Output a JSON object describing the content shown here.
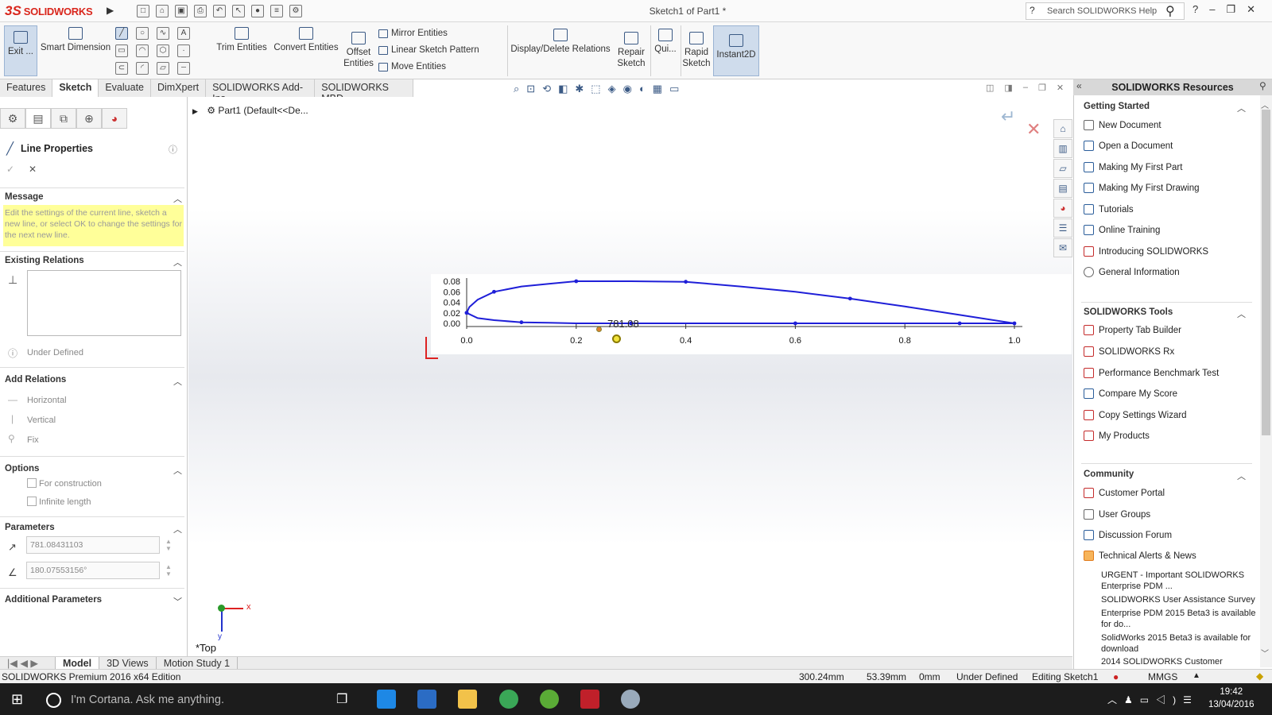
{
  "app": {
    "brand_prefix": "3S",
    "brand_name": "SOLIDWORKS",
    "window_title": "Sketch1 of Part1 *",
    "search_placeholder": "Search SOLIDWORKS Help"
  },
  "ribbon": {
    "exit": "Exit ...",
    "smart_dimension": "Smart Dimension",
    "trim": "Trim Entities",
    "convert": "Convert Entities",
    "offset": "Offset Entities",
    "mirror": "Mirror Entities",
    "linear_pattern": "Linear Sketch Pattern",
    "move": "Move Entities",
    "display_delete": "Display/Delete Relations",
    "repair": "Repair Sketch",
    "quick": "Qui...",
    "rapid": "Rapid Sketch",
    "instant2d": "Instant2D"
  },
  "tabs": [
    "Features",
    "Sketch",
    "Evaluate",
    "DimXpert",
    "SOLIDWORKS Add-Ins",
    "SOLIDWORKS MBD"
  ],
  "left": {
    "title": "Line Properties",
    "message_h": "Message",
    "message": "Edit the settings of the current line, sketch a new line, or select OK to change the settings for the next new line.",
    "existing_h": "Existing Relations",
    "under_defined": "Under Defined",
    "add_h": "Add Relations",
    "horizontal": "Horizontal",
    "vertical": "Vertical",
    "fix": "Fix",
    "options_h": "Options",
    "for_construction": "For construction",
    "infinite_length": "Infinite length",
    "params_h": "Parameters",
    "length": "781.08431103",
    "angle": "180.07553156°",
    "additional_h": "Additional Parameters"
  },
  "tree": {
    "root": "Part1  (Default<<De..."
  },
  "viewport": {
    "dimension": "781.08",
    "orientation": "*Top",
    "axis_x": "x",
    "axis_y": "y"
  },
  "chart_data": {
    "type": "line",
    "y_ticks": [
      "0.08",
      "0.06",
      "0.04",
      "0.02",
      "0.00"
    ],
    "x_ticks": [
      "0.0",
      "0.2",
      "0.4",
      "0.6",
      "0.8",
      "1.0"
    ],
    "xlim": [
      0,
      1.0
    ],
    "ylim": [
      0,
      0.08
    ],
    "series": [
      {
        "x": [
          0,
          0.005,
          0.02,
          0.05,
          0.1,
          0.15,
          0.2,
          0.25,
          0.3,
          0.4,
          0.5,
          0.6,
          0.7,
          0.8,
          0.9,
          1.0
        ],
        "y": [
          0.02,
          0.031,
          0.045,
          0.06,
          0.07,
          0.075,
          0.08,
          0.08,
          0.08,
          0.079,
          0.07,
          0.06,
          0.047,
          0.032,
          0.016,
          0.0
        ]
      },
      {
        "x": [
          0,
          0.02,
          0.05,
          0.1,
          0.15,
          0.2,
          0.3,
          0.4,
          0.5,
          0.6,
          0.7,
          0.8,
          0.9,
          1.0
        ],
        "y": [
          0.02,
          0.01,
          0.006,
          0.002,
          0.001,
          0.0,
          0.0,
          0.0,
          0.0,
          0.0,
          0.0,
          0.0,
          0.0,
          0.0
        ]
      }
    ],
    "colors": [
      "#1f1fd8"
    ]
  },
  "bottom_tabs": [
    "Model",
    "3D Views",
    "Motion Study 1"
  ],
  "right": {
    "header": "SOLIDWORKS Resources",
    "getting_started": "Getting Started",
    "gs_items": [
      "New Document",
      "Open a Document",
      "Making My First Part",
      "Making My First Drawing",
      "Tutorials",
      "Online Training",
      "Introducing SOLIDWORKS",
      "General Information"
    ],
    "tools": "SOLIDWORKS Tools",
    "tool_items": [
      "Property Tab Builder",
      "SOLIDWORKS Rx",
      "Performance Benchmark Test",
      "Compare My Score",
      "Copy Settings Wizard",
      "My Products"
    ],
    "community": "Community",
    "comm_items": [
      "Customer Portal",
      "User Groups",
      "Discussion Forum",
      "Technical Alerts & News"
    ],
    "news": [
      "URGENT - Important SOLIDWORKS Enterprise PDM ...",
      "SOLIDWORKS User Assistance Survey",
      "Enterprise PDM 2015 Beta3 is available for do...",
      "SolidWorks 2015 Beta3 is available for download",
      "2014 SOLIDWORKS Customer"
    ]
  },
  "status": {
    "edition": "SOLIDWORKS Premium 2016 x64 Edition",
    "x": "300.24mm",
    "y": "53.39mm",
    "z": "0mm",
    "state": "Under Defined",
    "editing": "Editing Sketch1",
    "units": "MMGS"
  },
  "taskbar": {
    "cortana": "I'm Cortana. Ask me anything.",
    "time": "19:42",
    "date": "13/04/2016"
  }
}
